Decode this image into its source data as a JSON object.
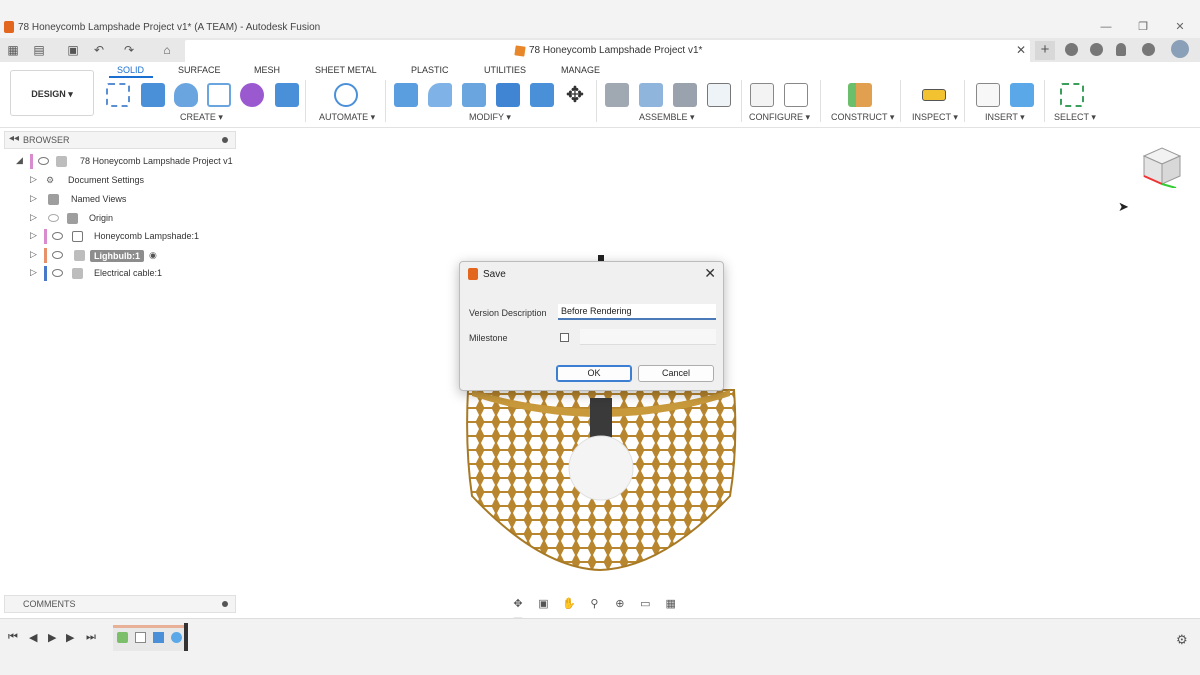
{
  "window": {
    "title": "78 Honeycomb Lampshade Project v1* (A TEAM) - Autodesk Fusion",
    "minimize": "—",
    "maximize": "❐",
    "close": "✕"
  },
  "doc_tab": {
    "title": "78 Honeycomb Lampshade Project v1*",
    "close": "✕",
    "plus": "+"
  },
  "ribbon": {
    "workspace_button": "DESIGN ▾",
    "tabs": [
      "SOLID",
      "SURFACE",
      "MESH",
      "SHEET METAL",
      "PLASTIC",
      "UTILITIES",
      "MANAGE"
    ],
    "active_tab": "SOLID",
    "groups": [
      "CREATE ▾",
      "AUTOMATE ▾",
      "MODIFY ▾",
      "ASSEMBLE ▾",
      "CONFIGURE ▾",
      "CONSTRUCT ▾",
      "INSPECT ▾",
      "INSERT ▾",
      "SELECT ▾"
    ]
  },
  "browser": {
    "title": "BROWSER",
    "items": [
      {
        "label": "78 Honeycomb Lampshade Project v1"
      },
      {
        "label": "Document Settings"
      },
      {
        "label": "Named Views"
      },
      {
        "label": "Origin"
      },
      {
        "label": "Honeycomb Lampshade:1"
      },
      {
        "label": "Lighbulb:1"
      },
      {
        "label": "Electrical cable:1"
      }
    ]
  },
  "comments": {
    "title": "COMMENTS"
  },
  "dialog": {
    "title": "Save",
    "close": "✕",
    "version_label": "Version Description",
    "version_value": "Before Rendering",
    "milestone_label": "Milestone",
    "milestone_checked": false,
    "ok": "OK",
    "cancel": "Cancel"
  },
  "colors": {
    "accent": "#1a6fd1",
    "lampshade": "#c99a3c",
    "fusion_orange": "#e2661e"
  }
}
